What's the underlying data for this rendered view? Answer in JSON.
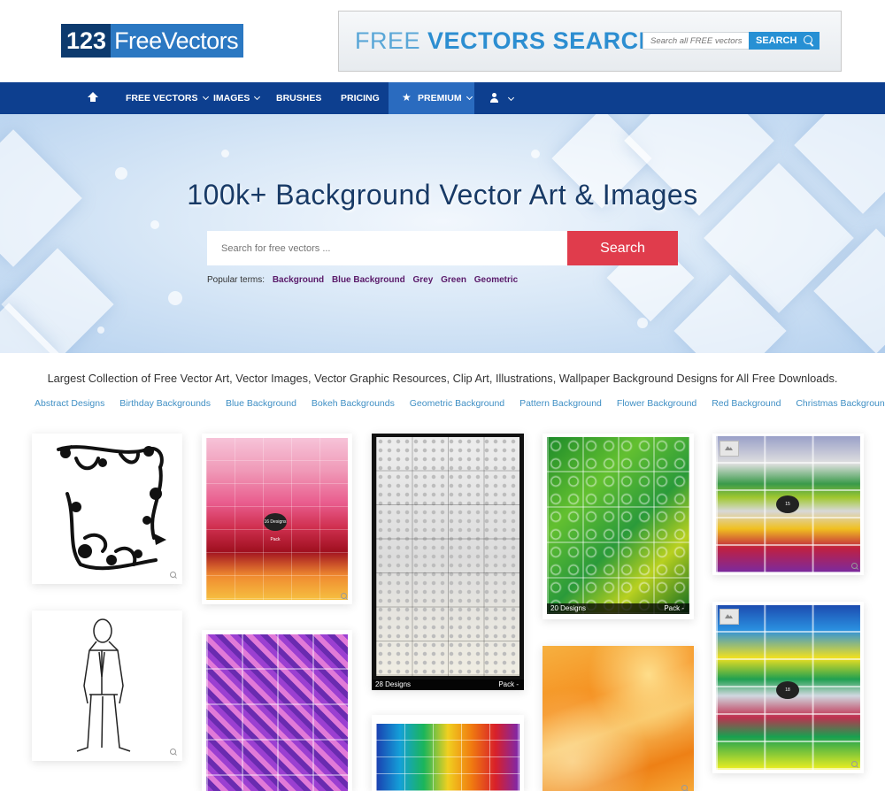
{
  "header": {
    "logo_number": "123",
    "logo_text": "FreeVectors",
    "banner": {
      "title_light": "FREE",
      "title_bold": "VECTORS SEARCH",
      "input_placeholder": "Search all FREE vectors",
      "button_label": "SEARCH"
    }
  },
  "nav": {
    "items": [
      {
        "label": "FREE VECTORS",
        "dropdown": true
      },
      {
        "label": "IMAGES",
        "dropdown": true
      },
      {
        "label": "BRUSHES",
        "dropdown": false
      },
      {
        "label": "PRICING",
        "dropdown": false
      },
      {
        "label": "PREMIUM",
        "dropdown": true
      }
    ],
    "icons": [
      "home-icon",
      "star-icon",
      "user-icon"
    ],
    "active_color": "#2a6bbf",
    "bar_color": "#0d3f8f"
  },
  "hero": {
    "title": "100k+ Background Vector Art & Images",
    "search_placeholder": "Search for free vectors ...",
    "search_button": "Search",
    "popular_label": "Popular terms:",
    "popular_terms": [
      "Background",
      "Blue Background",
      "Grey",
      "Green",
      "Geometric"
    ]
  },
  "tagline": "Largest Collection of Free Vector Art, Vector Images, Vector Graphic Resources, Clip Art, Illustrations, Wallpaper Background Designs for All Free Downloads.",
  "categories": [
    "Abstract Designs",
    "Birthday Backgrounds",
    "Blue Background",
    "Bokeh Backgrounds",
    "Geometric Background",
    "Pattern Background",
    "Flower Background",
    "Red Background",
    "Christmas Background"
  ],
  "gallery": {
    "grey_pack": {
      "count_label": "28 Designs",
      "pack_label": "Pack -"
    },
    "green_pack": {
      "count_label": "20 Designs",
      "pack_label": "Pack -"
    },
    "pink_pack_badge": "16 Designs Pack",
    "multi_pack_badge": "15",
    "abstract_pack_badge": "18"
  },
  "colors": {
    "search_button": "#e03c4c",
    "popular_link": "#5a1a6a",
    "category_link": "#3f8fc4",
    "logo_dark": "#0d3a6e",
    "logo_light": "#2b78c2"
  }
}
